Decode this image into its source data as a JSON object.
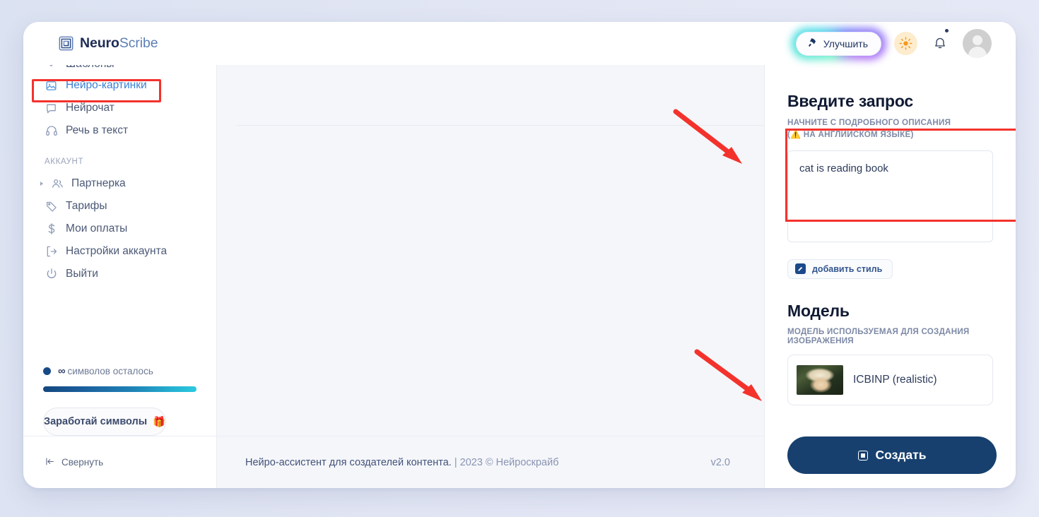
{
  "brand": {
    "name_bold": "Neuro",
    "name_light": "Scribe",
    "logo_icon": "layers-square-icon"
  },
  "header": {
    "upgrade_label": "Улучшить",
    "rocket_icon": "rocket-icon",
    "theme_icon": "sun-icon",
    "notifications_icon": "bell-icon",
    "avatar_icon": "user-avatar-icon"
  },
  "sidebar": {
    "clipped_item_label": "Шаблоны",
    "items": [
      {
        "label": "Нейро-картинки",
        "icon": "image-icon",
        "active": true
      },
      {
        "label": "Нейрочат",
        "icon": "chat-bubble-icon",
        "active": false
      },
      {
        "label": "Речь в текст",
        "icon": "headphones-icon",
        "active": false
      }
    ],
    "section_label": "АККАУНТ",
    "account_items": [
      {
        "label": "Партнерка",
        "icon": "users-icon",
        "caret": true
      },
      {
        "label": "Тарифы",
        "icon": "tag-icon",
        "caret": false
      },
      {
        "label": "Мои оплаты",
        "icon": "dollar-icon",
        "caret": false
      },
      {
        "label": "Настройки аккаунта",
        "icon": "logout-bracket-icon",
        "caret": false
      },
      {
        "label": "Выйти",
        "icon": "power-icon",
        "caret": false
      }
    ],
    "tokens_symbol": "∞",
    "tokens_label": "символов осталось",
    "earn_label": "Заработай символы",
    "earn_icon": "gift-icon",
    "collapse_label": "Свернуть",
    "collapse_icon": "collapse-left-icon"
  },
  "footer": {
    "text": "Нейро-ассистент для создателей контента.",
    "copyright": "| 2023 © Нейроскрайб",
    "version": "v2.0"
  },
  "panel": {
    "prompt_title": "Введите запрос",
    "prompt_hint_line1": "НАЧНИТЕ С ПОДРОБНОГО ОПИСАНИЯ",
    "prompt_hint_line2_pre": "(",
    "prompt_hint_warn_icon": "⚠",
    "prompt_hint_line2_post": " НА АНГЛИЙСКОМ ЯЗЫКЕ)",
    "prompt_value": "cat is reading book",
    "prompt_placeholder": "",
    "style_button_label": "добавить стиль",
    "style_button_icon": "edit-square-icon",
    "model_title": "Модель",
    "model_subtitle": "МОДЕЛЬ ИСПОЛЬЗУЕМАЯ ДЛЯ СОЗДАНИЯ ИЗОБРАЖЕНИЯ",
    "model_name": "ICBINP (realistic)",
    "model_thumb_icon": "model-preview-thumbnail",
    "create_label": "Создать",
    "create_icon": "plus-square-icon"
  },
  "annotations": {
    "highlight_color": "#f4322c",
    "arrow_icon": "red-arrow-icon",
    "count": 2
  },
  "colors": {
    "page_bg": "#dde3f2",
    "card_bg": "#f5f6fa",
    "panel_bg": "#ffffff",
    "accent_blue": "#3b7fd4",
    "primary_dark": "#17406f",
    "highlight_red": "#f4322c"
  }
}
